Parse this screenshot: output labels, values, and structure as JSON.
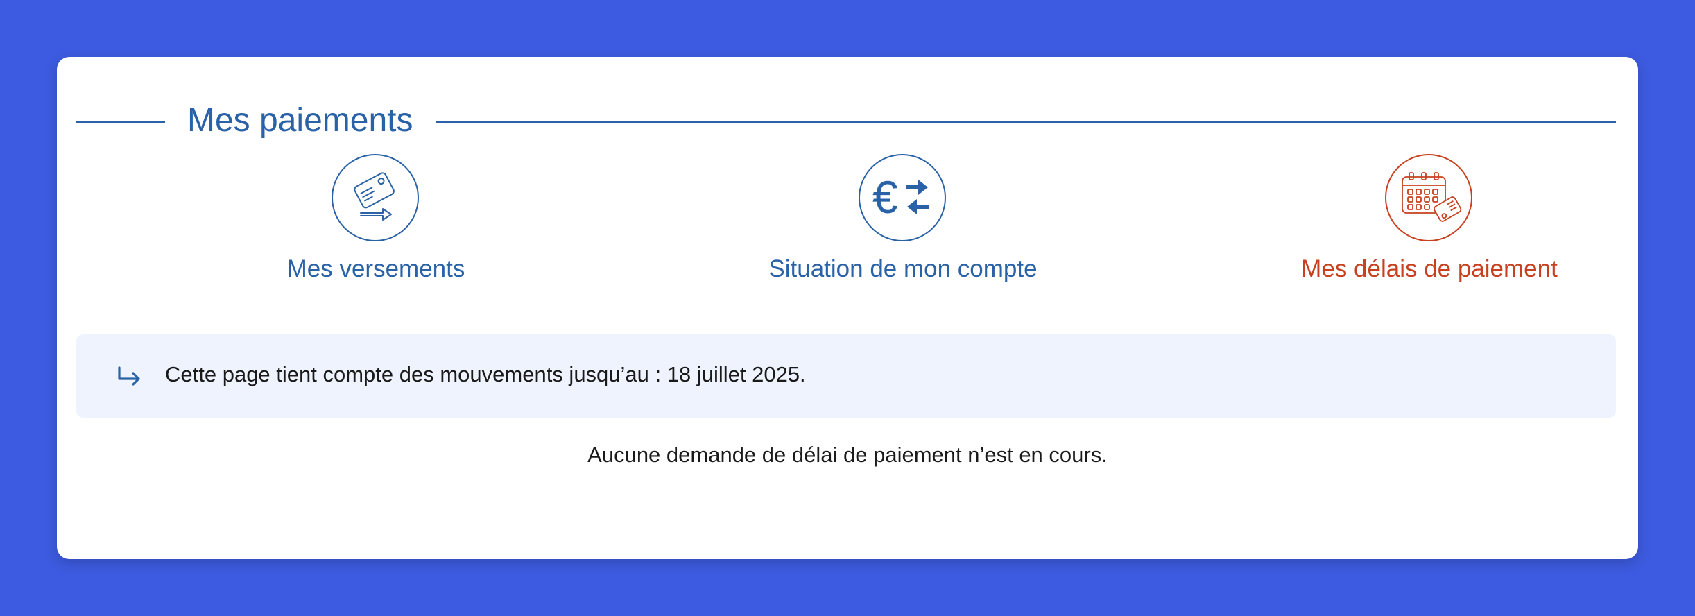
{
  "section": {
    "title": "Mes paiements"
  },
  "nav": {
    "items": [
      {
        "label": "Mes versements",
        "icon": "card-payment-icon",
        "active": false
      },
      {
        "label": "Situation de mon compte",
        "icon": "euro-exchange-icon",
        "active": false
      },
      {
        "label": "Mes délais de paiement",
        "icon": "calendar-payment-icon",
        "active": true
      }
    ]
  },
  "info": {
    "icon": "return-arrow-icon",
    "text": "Cette page tient compte des mouvements jusqu’au : 18 juillet 2025."
  },
  "message": {
    "text": "Aucune demande de délai de paiement n’est en cours."
  },
  "colors": {
    "background": "#3d5be0",
    "primary": "#2a62a8",
    "active": "#c7401f",
    "info_bg": "#eef3fd"
  }
}
